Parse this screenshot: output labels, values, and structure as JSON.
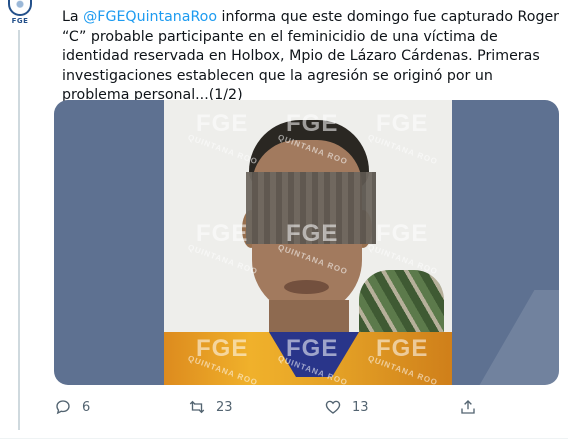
{
  "author": {
    "avatar_abbr": "FGE"
  },
  "tweet": {
    "mention": "@FGEQuintanaRoo",
    "text_prefix": "La ",
    "text_suffix": " informa que este domingo fue capturado Roger “C” probable participante en el feminicidio de una víctima de identidad reservada en Holbox, Mpio de Lázaro Cárdenas. Primeras investigaciones establecen que la agresión se originó por un problema personal...(1/2)"
  },
  "media": {
    "watermark_main": "FGE",
    "watermark_sub": "QUINTANA ROO"
  },
  "actions": {
    "reply_count": "6",
    "retweet_count": "23",
    "like_count": "13",
    "reply_icon": "reply-icon",
    "retweet_icon": "retweet-icon",
    "like_icon": "heart-icon",
    "share_icon": "share-icon"
  },
  "colors": {
    "mention": "#1d9bf0",
    "icon_gray": "#536471",
    "media_bg": "#5e7191"
  }
}
